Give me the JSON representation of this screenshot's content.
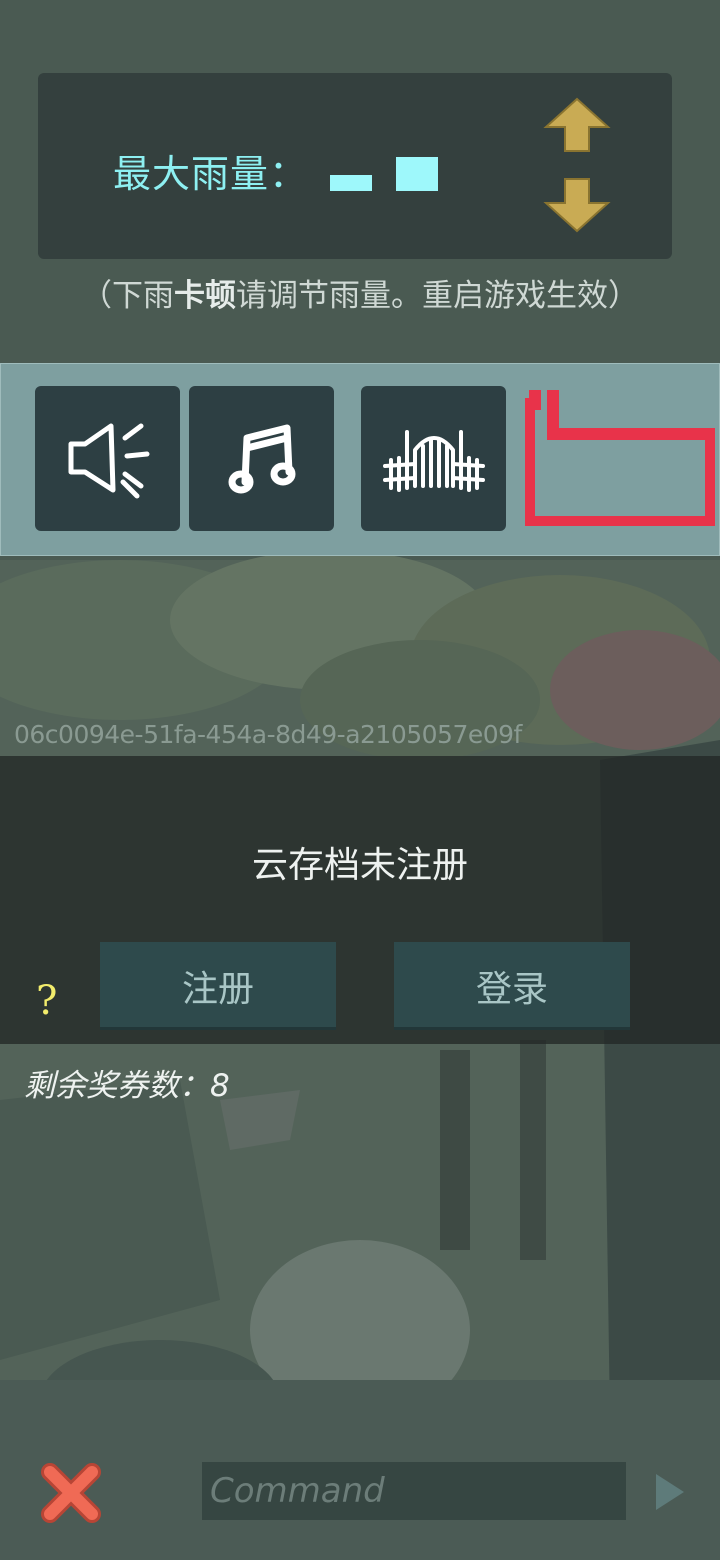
{
  "rain_settings": {
    "label": "最大雨量：",
    "hint_prefix": "（下雨",
    "hint_bold": "卡顿",
    "hint_suffix": "请调节雨量。重启游戏生效）",
    "up_icon": "arrow-up-icon",
    "down_icon": "arrow-down-icon"
  },
  "toggles": {
    "items": [
      "speaker-icon",
      "music-note-icon",
      "garden-gate-icon"
    ]
  },
  "device_id": "06c0094e-51fa-454a-8d49-a2105057e09f",
  "cloud_save": {
    "status": "云存档未注册",
    "register_label": "注册",
    "login_label": "登录",
    "help_label": "?"
  },
  "coupons": {
    "text": "剩余奖券数：8"
  },
  "command": {
    "placeholder": "Command"
  },
  "colors": {
    "accent_cyan": "#8ef0f2",
    "arrow_gold": "#c9ab54",
    "highlight_red": "#e8334a",
    "close_red": "#f06a55"
  }
}
